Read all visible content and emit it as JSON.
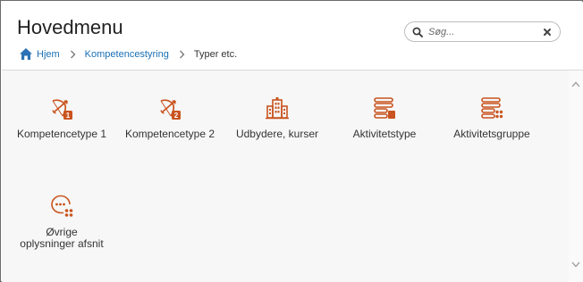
{
  "header": {
    "title": "Hovedmenu"
  },
  "breadcrumb": {
    "home_label": "Hjem",
    "items": [
      {
        "label": "Kompetencestyring"
      },
      {
        "label": "Typer etc."
      }
    ]
  },
  "search": {
    "placeholder": "Søg...",
    "value": ""
  },
  "tiles": [
    {
      "label": "Kompetencetype 1",
      "icon": "bow-arrow-1-icon"
    },
    {
      "label": "Kompetencetype 2",
      "icon": "bow-arrow-2-icon"
    },
    {
      "label": "Udbydere, kurser",
      "icon": "buildings-icon"
    },
    {
      "label": "Aktivitetstype",
      "icon": "stack-tag-icon"
    },
    {
      "label": "Aktivitetsgruppe",
      "icon": "stack-dots-icon"
    },
    {
      "label": "Øvrige oplysninger afsnit",
      "icon": "chat-dots-icon"
    }
  ],
  "colors": {
    "accent_orange": "#c9541f",
    "link_blue": "#1a6fb5",
    "home_icon_blue": "#2a72b5"
  }
}
